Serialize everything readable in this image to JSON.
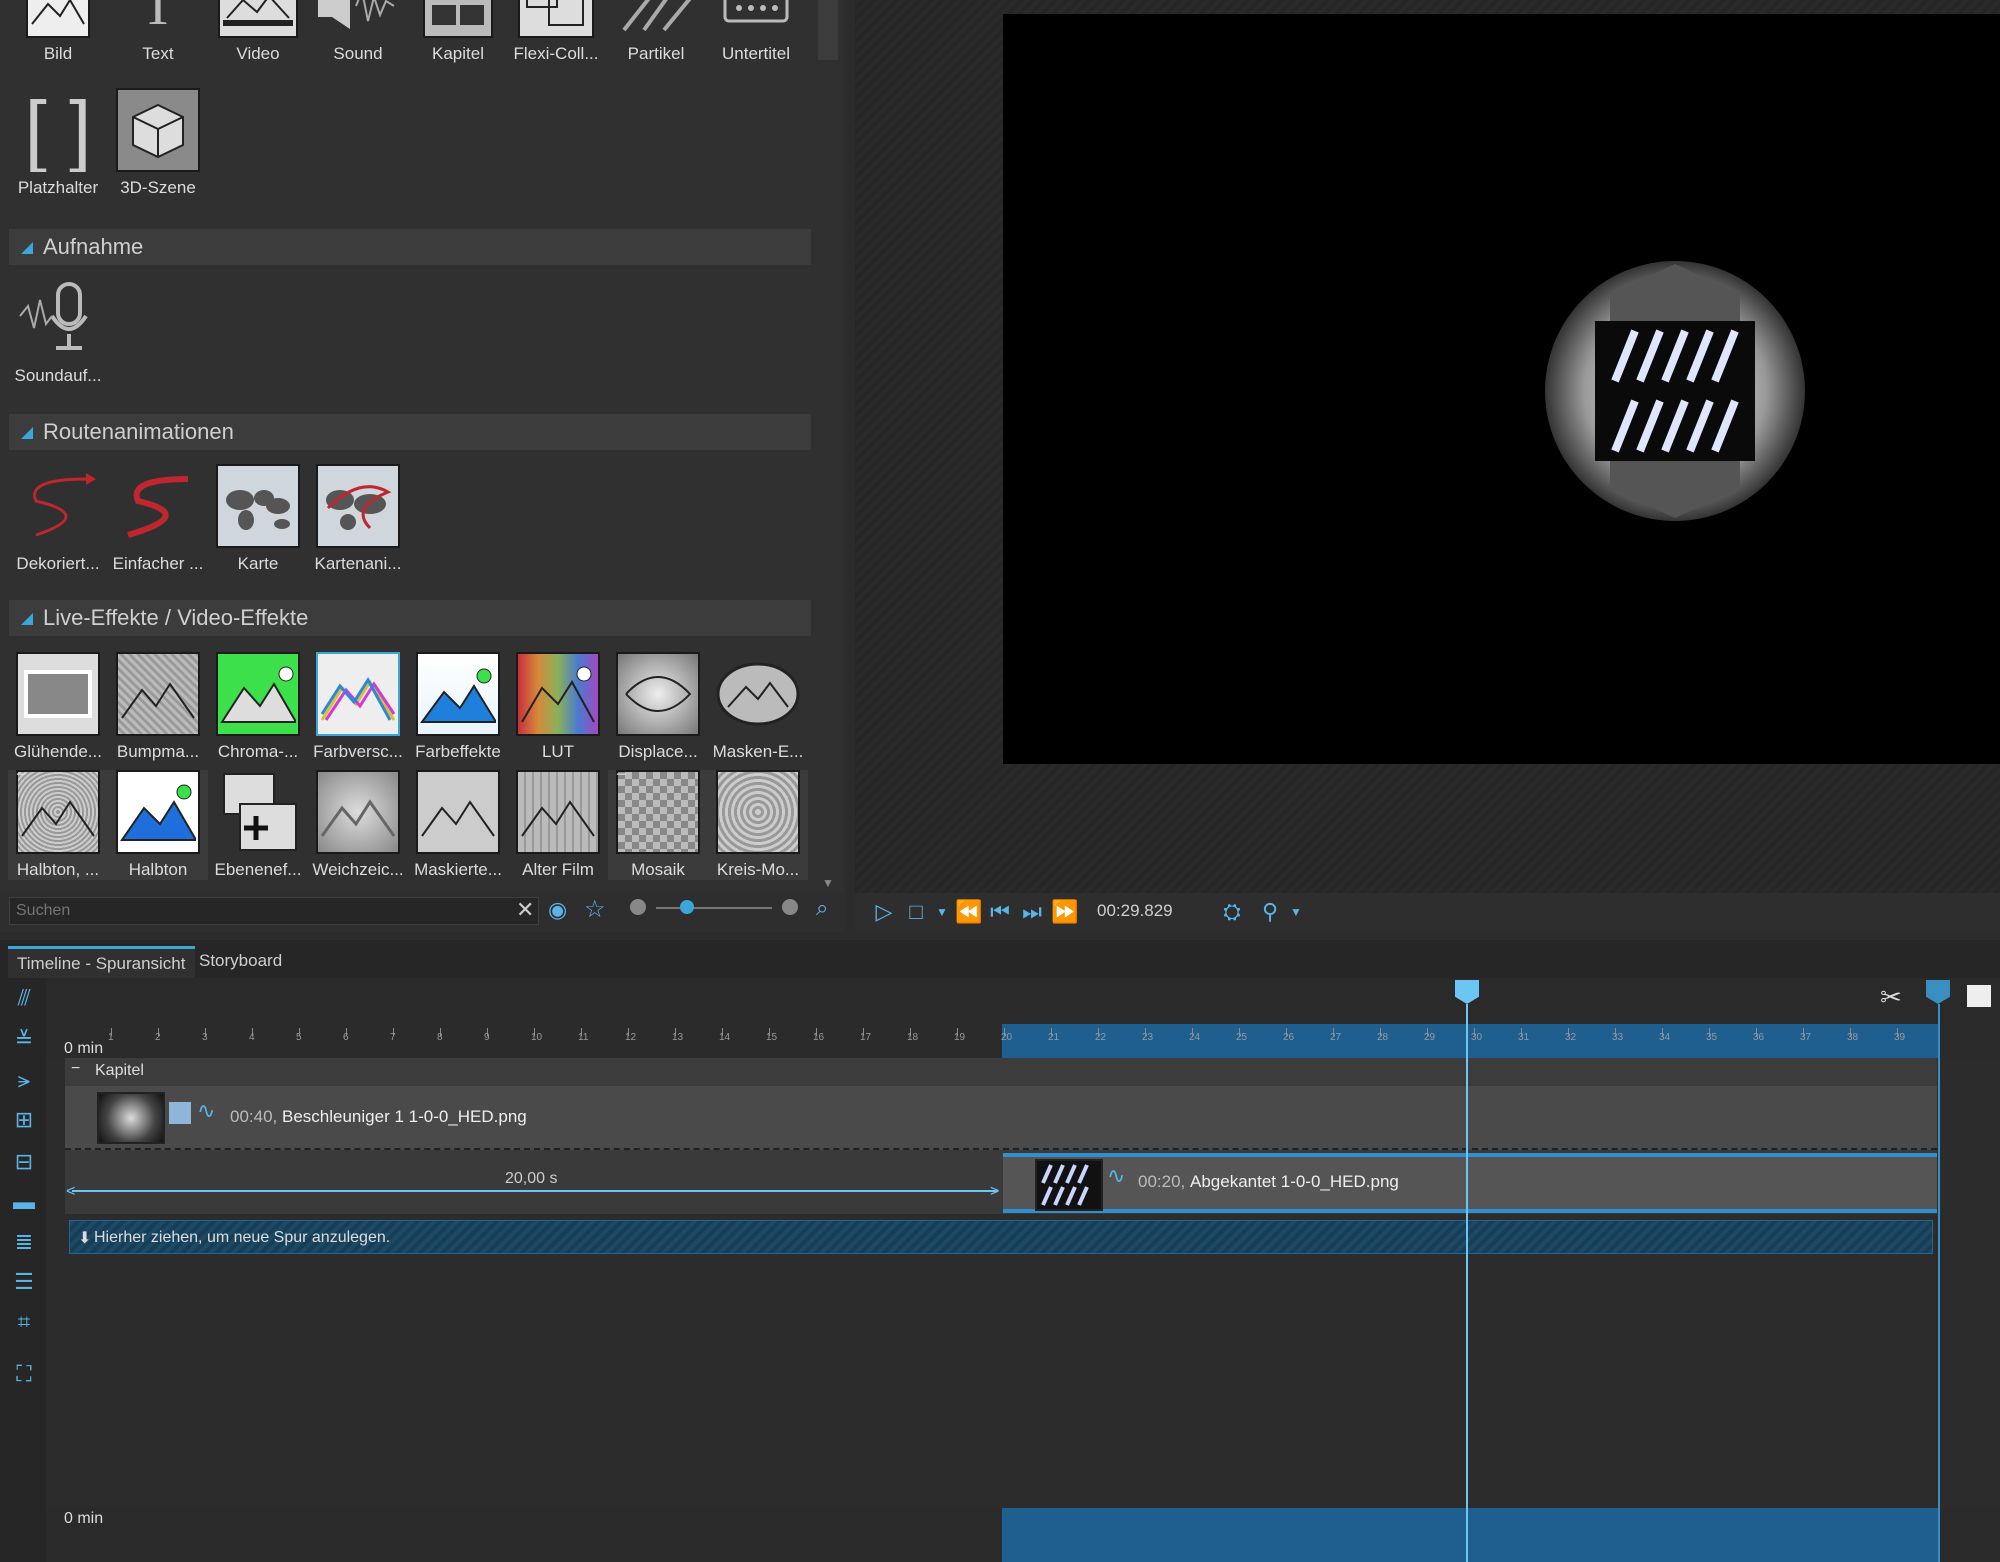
{
  "toolbox": {
    "row1": [
      "Bild",
      "Text",
      "Video",
      "Sound",
      "Kapitel",
      "Flexi-Coll...",
      "Partikel",
      "Untertitel"
    ],
    "row2": [
      "Platzhalter",
      "3D-Szene"
    ],
    "sections": {
      "aufnahme": {
        "title": "Aufnahme",
        "items": [
          "Soundauf..."
        ]
      },
      "routen": {
        "title": "Routenanimationen",
        "items": [
          "Dekoriert...",
          "Einfacher ...",
          "Karte",
          "Kartenani..."
        ]
      },
      "live": {
        "title": "Live-Effekte / Video-Effekte",
        "row1": [
          "Glühende...",
          "Bumpma...",
          "Chroma-...",
          "Farbversc...",
          "Farbeffekte",
          "LUT",
          "Displace...",
          "Masken-E..."
        ],
        "row2": [
          "Halbton, ...",
          "Halbton",
          "Ebenenef...",
          "Weichzeic...",
          "Maskierte...",
          "Alter Film",
          "Mosaik",
          "Kreis-Mo..."
        ]
      }
    }
  },
  "search": {
    "placeholder": "Suchen"
  },
  "player": {
    "timecode": "00:29.829"
  },
  "tabs": {
    "timeline": "Timeline - Spuransicht",
    "storyboard": "Storyboard"
  },
  "timeline": {
    "ruler_start": "0 min",
    "chapter": "Kapitel",
    "track1_clip": {
      "duration": "00:40,",
      "name": "Beschleuniger 1 1-0-0_HED.png"
    },
    "track2_clip": {
      "duration": "00:20,",
      "name": "Abgekantet 1-0-0_HED.png"
    },
    "gap_label": "20,00 s",
    "drop_hint": "Hierher ziehen, um neue Spur anzulegen.",
    "bottom_ruler_start": "0 min",
    "tick_labels": [
      "1",
      "2",
      "3",
      "4",
      "5",
      "6",
      "7",
      "8",
      "9",
      "10",
      "11",
      "12",
      "13",
      "14",
      "15",
      "16",
      "17",
      "18",
      "19",
      "20",
      "21",
      "22",
      "23",
      "24",
      "25",
      "26",
      "27",
      "28",
      "29",
      "30",
      "31",
      "32",
      "33",
      "34",
      "35",
      "36",
      "37",
      "38",
      "39"
    ]
  },
  "colors": {
    "accent": "#3ba6d8",
    "selection": "#1f5f8f",
    "playhead": "#6cc5f2"
  }
}
